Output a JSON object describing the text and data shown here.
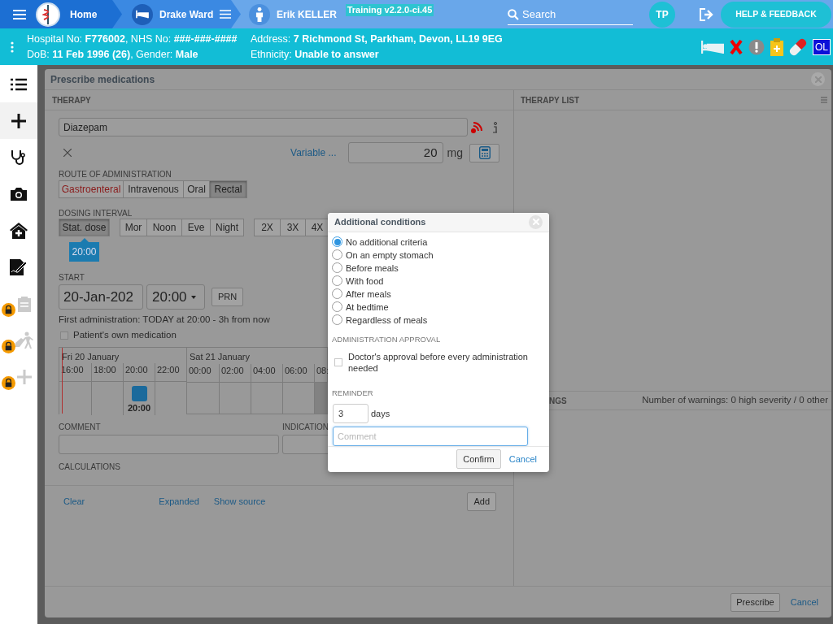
{
  "header": {
    "breadcrumbs": [
      {
        "label": "Home",
        "kind": "home"
      },
      {
        "label": "Drake Ward",
        "kind": "ward"
      },
      {
        "label": "Erik KELLER",
        "kind": "patient"
      }
    ],
    "environment": "Training v2.2.0-ci.45",
    "search": {
      "placeholder": "Search"
    },
    "user_initials": "TP",
    "help_button": "HELP & FEEDBACK"
  },
  "patient_bar": {
    "left_lines": [
      "Hospital No: **F776002**, NHS No: **###-###-####**",
      "DoB: **11 Feb 1996 (26)**, Gender: **Male**"
    ],
    "right_lines": [
      "Address: **7 Richmond St, Parkham, Devon, LL19 9EG**",
      "Ethnicity: **Unable to answer**"
    ],
    "status_icons": [
      {
        "kind": "bed"
      },
      {
        "kind": "cross"
      },
      {
        "kind": "alert"
      },
      {
        "kind": "clipboard"
      },
      {
        "kind": "pill"
      },
      {
        "kind": "badge",
        "label": "OL"
      }
    ]
  },
  "sidebar": {
    "items": [
      {
        "kind": "list",
        "selected": false,
        "locked": false
      },
      {
        "kind": "plus",
        "selected": true,
        "locked": false
      },
      {
        "kind": "stethoscope",
        "selected": false,
        "locked": false
      },
      {
        "kind": "camera",
        "selected": false,
        "locked": false
      },
      {
        "kind": "house",
        "selected": false,
        "locked": false
      },
      {
        "kind": "document",
        "selected": false,
        "locked": false
      },
      {
        "kind": "clipboard",
        "selected": false,
        "locked": true
      },
      {
        "kind": "walking",
        "selected": false,
        "locked": true
      },
      {
        "kind": "plus",
        "selected": false,
        "locked": true
      }
    ]
  },
  "dialog": {
    "title": "Prescribe medications",
    "therapy": {
      "heading": "THERAPY",
      "medicine": "Diazepam",
      "variable_link": "Variable ...",
      "dose": "20",
      "unit": "mg",
      "route_label": "ROUTE OF ADMINISTRATION",
      "routes": [
        {
          "label": "Gastroenteral",
          "selected": false,
          "flagged": true
        },
        {
          "label": "Intravenous",
          "selected": false,
          "flagged": false
        },
        {
          "label": "Oral",
          "selected": false,
          "flagged": false
        },
        {
          "label": "Rectal",
          "selected": true,
          "flagged": false
        }
      ],
      "interval_label": "DOSING INTERVAL",
      "interval_groups": [
        [
          {
            "label": "Stat. dose",
            "selected": true
          }
        ],
        [
          {
            "label": "Mor",
            "selected": false
          },
          {
            "label": "Noon",
            "selected": false
          },
          {
            "label": "Eve",
            "selected": false
          },
          {
            "label": "Night",
            "selected": false
          }
        ],
        [
          {
            "label": "2X",
            "selected": false
          },
          {
            "label": "3X",
            "selected": false
          },
          {
            "label": "4X",
            "selected": false
          }
        ]
      ],
      "time_tooltip": "20:00",
      "start_label": "START",
      "start_date": "20-Jan-202",
      "start_time": "20:00",
      "prn_button": "PRN",
      "first_administration": "First administration: TODAY at 20:00 - 3h from now",
      "own_medication": {
        "label": "Patient's own medication",
        "checked": false
      },
      "timeline": {
        "days": [
          {
            "label": "Fri 20 January",
            "hours": [
              {
                "label": "16:00",
                "dose": false,
                "shaded": false
              },
              {
                "label": "18:00",
                "dose": false,
                "shaded": false
              },
              {
                "label": "20:00",
                "dose": true,
                "dose_label": "20:00",
                "shaded": false
              },
              {
                "label": "22:00",
                "dose": false,
                "shaded": false
              }
            ]
          },
          {
            "label": "Sat 21 January",
            "hours": [
              {
                "label": "00:00",
                "dose": false,
                "shaded": false
              },
              {
                "label": "02:00",
                "dose": false,
                "shaded": false
              },
              {
                "label": "04:00",
                "dose": false,
                "shaded": false
              },
              {
                "label": "06:00",
                "dose": false,
                "shaded": false
              },
              {
                "label": "08:",
                "dose": false,
                "shaded": true
              }
            ]
          }
        ]
      },
      "comment_label": "COMMENT",
      "indication_label": "INDICATION",
      "calculations_label": "CALCULATIONS",
      "footer_links": [
        "Clear",
        "Expanded",
        "Show source"
      ],
      "add_button": "Add"
    },
    "therapy_list": {
      "heading": "THERAPY LIST",
      "warnings_heading": "NGS",
      "warnings_count": "Number of warnings: 0 high severity / 0 other"
    },
    "prescribe_button": "Prescribe",
    "cancel_link": "Cancel"
  },
  "popup": {
    "title": "Additional conditions",
    "options": [
      {
        "label": "No additional criteria",
        "selected": true
      },
      {
        "label": "On an empty stomach",
        "selected": false
      },
      {
        "label": "Before meals",
        "selected": false
      },
      {
        "label": "With food",
        "selected": false
      },
      {
        "label": "After meals",
        "selected": false
      },
      {
        "label": "At bedtime",
        "selected": false
      },
      {
        "label": "Regardless of meals",
        "selected": false
      }
    ],
    "approval_label": "ADMINISTRATION APPROVAL",
    "approval": {
      "label": "Doctor's approval before every administration needed",
      "checked": false
    },
    "reminder_label": "REMINDER",
    "reminder_value": "3",
    "reminder_unit": "days",
    "comment": {
      "placeholder": "Comment"
    },
    "confirm_button": "Confirm",
    "cancel_link": "Cancel"
  }
}
